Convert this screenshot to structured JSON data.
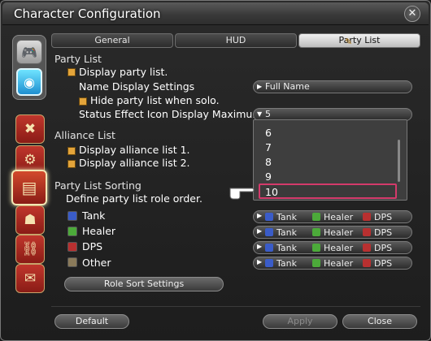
{
  "window": {
    "title": "Character Configuration"
  },
  "tabs": [
    {
      "label": "General"
    },
    {
      "label": "HUD"
    },
    {
      "label": "Party List"
    }
  ],
  "party_list": {
    "heading": "Party List",
    "display_party_list": "Display party list.",
    "name_display_settings": {
      "label": "Name Display Settings",
      "value": "Full Name"
    },
    "hide_party_list_solo": "Hide party list when solo.",
    "status_effect_icon_max": {
      "label": "Status Effect Icon Display Maximum",
      "value": "5"
    }
  },
  "dropdown_popup": {
    "options": [
      "6",
      "7",
      "8",
      "9",
      "10"
    ],
    "selected": "10"
  },
  "alliance_list": {
    "heading": "Alliance List",
    "display_alliance_1": "Display alliance list 1.",
    "display_alliance_2": "Display alliance list 2."
  },
  "sorting": {
    "heading": "Party List Sorting",
    "description": "Define party list role order.",
    "roles": [
      {
        "label": "Tank",
        "order": [
          "Tank",
          "Healer",
          "DPS"
        ]
      },
      {
        "label": "Healer",
        "order": [
          "Tank",
          "Healer",
          "DPS"
        ]
      },
      {
        "label": "DPS",
        "order": [
          "Tank",
          "Healer",
          "DPS"
        ]
      },
      {
        "label": "Other",
        "order": [
          "Tank",
          "Healer",
          "DPS"
        ]
      }
    ],
    "role_sort_button": "Role Sort Settings"
  },
  "footer": {
    "default": "Default",
    "apply": "Apply",
    "close": "Close"
  },
  "colors": {
    "checkbox": "#e3a43a",
    "tank": "#3a5cc8",
    "healer": "#4caa3a",
    "dps": "#b83030",
    "selection_border": "#d43a6b"
  }
}
